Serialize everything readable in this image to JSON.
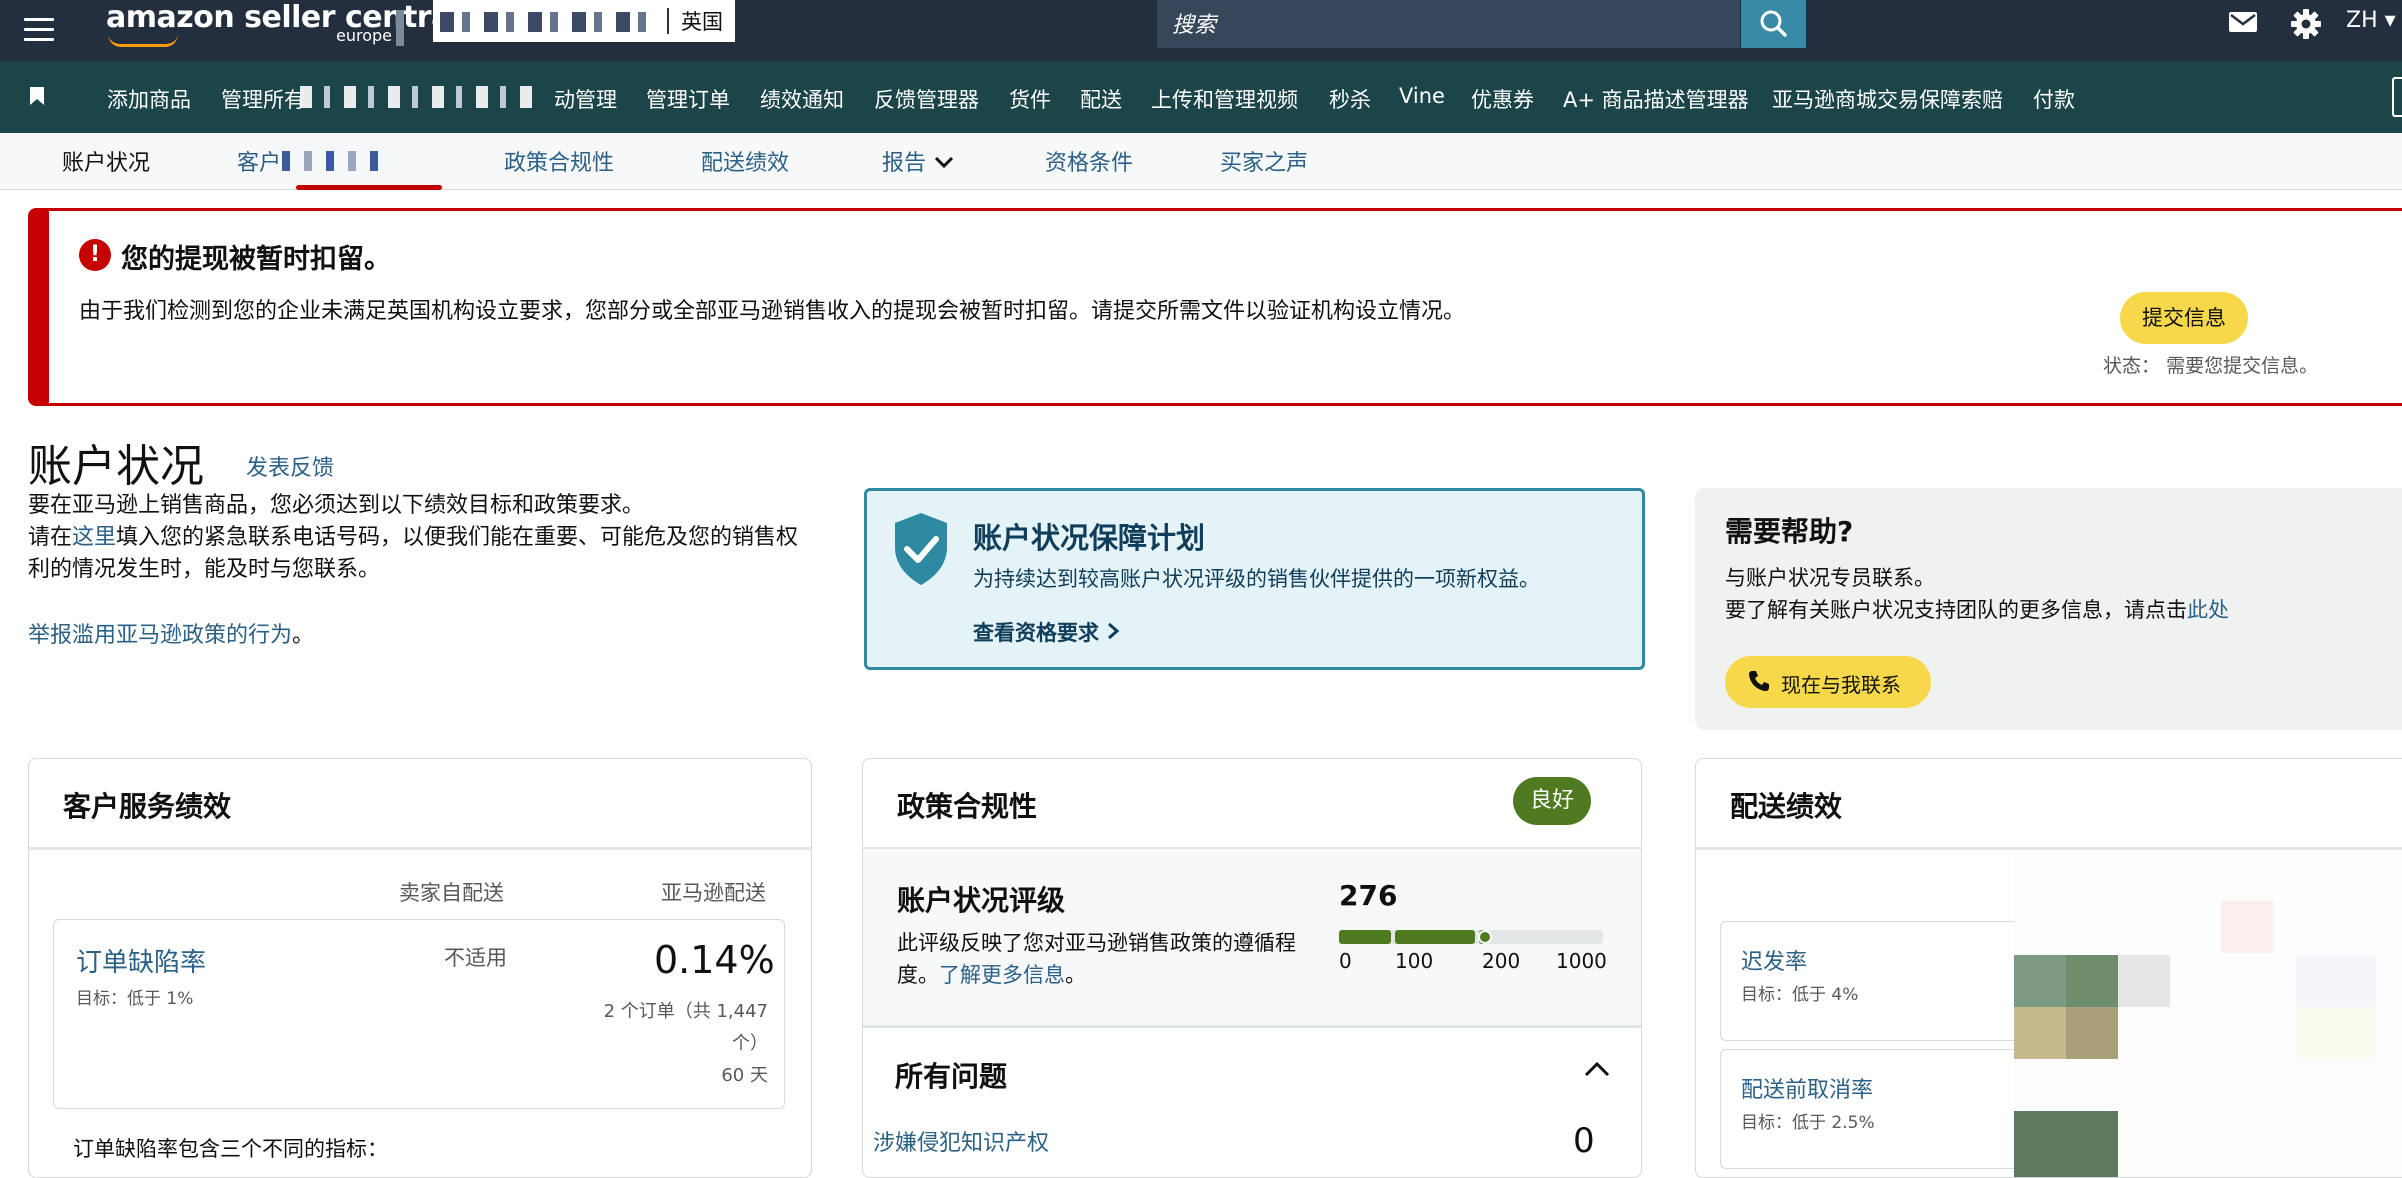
{
  "topbar": {
    "logo": "amazon seller central",
    "logo_region": "europe",
    "store_country": "英国",
    "search_placeholder": "搜索",
    "language": "ZH"
  },
  "nav": {
    "items": [
      "添加商品",
      "管理所有",
      "动管理",
      "管理订单",
      "绩效通知",
      "反馈管理器",
      "货件",
      "配送",
      "上传和管理视频",
      "秒杀",
      "Vine",
      "优惠券",
      "A+ 商品描述管理器",
      "亚马逊商城交易保障索赔",
      "付款"
    ]
  },
  "tabs": {
    "items": [
      "账户状况",
      "客户",
      "政策合规性",
      "配送绩效",
      "报告",
      "资格条件",
      "买家之声"
    ]
  },
  "alert": {
    "title": "您的提现被暂时扣留。",
    "body": "由于我们检测到您的企业未满足英国机构设立要求，您部分或全部亚马逊销售收入的提现会被暂时扣留。请提交所需文件以验证机构设立情况。",
    "button": "提交信息",
    "status_label": "状态：",
    "status_value": "需要您提交信息。",
    "accent_color": "#c40000"
  },
  "header": {
    "title": "账户状况",
    "feedback_link": "发表反馈",
    "line1": "要在亚马逊上销售商品，您必须达到以下绩效目标和政策要求。",
    "line2_pre": "请在",
    "line2_link": "这里",
    "line2_post": "填入您的紧急联系电话号码，以便我们能在重要、可能危及您的销售权利的情况发生时，能及时与您联系。",
    "report_link": "举报滥用亚马逊政策的行为",
    "report_end": "。"
  },
  "protection": {
    "title": "账户状况保障计划",
    "subtitle": "为持续达到较高账户状况评级的销售伙伴提供的一项新权益。",
    "link": "查看资格要求"
  },
  "help": {
    "title": "需要帮助?",
    "line1": "与账户状况专员联系。",
    "line2_pre": "要了解有关账户状况支持团队的更多信息，请点击",
    "line2_link": "此处",
    "button": "现在与我联系"
  },
  "customer_service": {
    "title": "客户服务绩效",
    "col_merchant": "卖家自配送",
    "col_amazon": "亚马逊配送",
    "metric_name": "订单缺陷率",
    "metric_target": "目标：低于 1%",
    "merchant_value": "不适用",
    "amazon_value": "0.14%",
    "amazon_detail": "2 个订单（共 1,447 个）",
    "period": "60 天",
    "footer": "订单缺陷率包含三个不同的指标："
  },
  "policy": {
    "title": "政策合规性",
    "badge": "良好",
    "badge_color": "#507a1f",
    "rating_title": "账户状况评级",
    "rating_desc": "此评级反映了您对亚马逊销售政策的遵循程度。",
    "rating_link": "了解更多信息",
    "rating_end": "。",
    "rating_value": "276",
    "scale_ticks": [
      "0",
      "100",
      "200",
      "1000"
    ],
    "issues_title": "所有问题",
    "issue1_label": "涉嫌侵犯知识产权",
    "issue1_value": "0"
  },
  "shipping": {
    "title": "配送绩效",
    "metrics": [
      {
        "name": "迟发率",
        "target": "目标：低于 4%"
      },
      {
        "name": "配送前取消率",
        "target": "目标：低于 2.5%"
      }
    ]
  }
}
